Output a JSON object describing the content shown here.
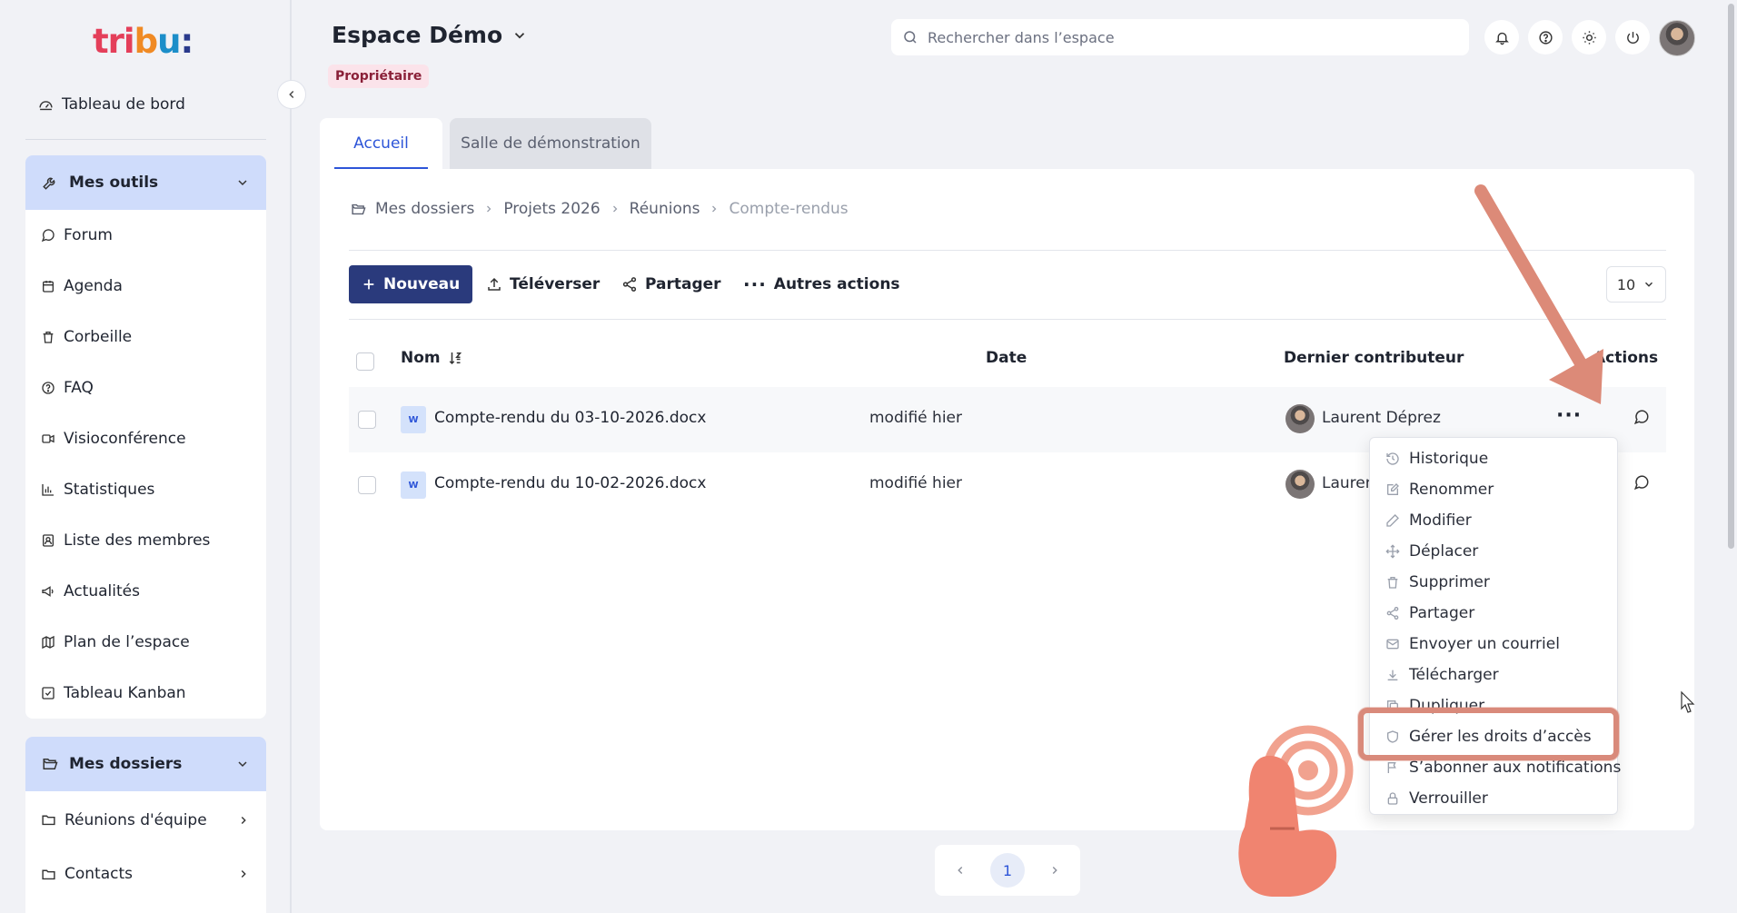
{
  "sidebar": {
    "logo_parts": [
      "tri",
      "b",
      "u",
      ":"
    ],
    "dashboard_label": "Tableau de bord",
    "tools_header": "Mes outils",
    "tools": [
      {
        "label": "Forum",
        "icon": "forum-icon"
      },
      {
        "label": "Agenda",
        "icon": "calendar-icon"
      },
      {
        "label": "Corbeille",
        "icon": "trash-icon"
      },
      {
        "label": "FAQ",
        "icon": "help-icon"
      },
      {
        "label": "Visioconférence",
        "icon": "video-icon"
      },
      {
        "label": "Statistiques",
        "icon": "chart-icon"
      },
      {
        "label": "Liste des membres",
        "icon": "members-icon"
      },
      {
        "label": "Actualités",
        "icon": "megaphone-icon"
      },
      {
        "label": "Plan de l’espace",
        "icon": "map-icon"
      },
      {
        "label": "Tableau Kanban",
        "icon": "kanban-icon"
      }
    ],
    "folders_header": "Mes dossiers",
    "folders": [
      {
        "label": "Réunions d'équipe"
      },
      {
        "label": "Contacts"
      }
    ]
  },
  "header": {
    "space_title": "Espace Démo",
    "role_badge": "Propriétaire",
    "search_placeholder": "Rechercher dans l’espace"
  },
  "tabs": [
    {
      "label": "Accueil",
      "active": true
    },
    {
      "label": "Salle de démonstration",
      "active": false
    }
  ],
  "breadcrumb": [
    "Mes dossiers",
    "Projets 2026",
    "Réunions",
    "Compte-rendus"
  ],
  "toolbar": {
    "new_label": "Nouveau",
    "upload_label": "Téléverser",
    "share_label": "Partager",
    "more_label": "Autres actions",
    "per_page": "10"
  },
  "table": {
    "headers": {
      "name": "Nom",
      "date": "Date",
      "contributor": "Dernier contributeur",
      "actions": "Actions"
    },
    "rows": [
      {
        "type": "W",
        "name": "Compte-rendu du 03-10-2026.docx",
        "date": "modifié hier",
        "contributor": "Laurent Déprez"
      },
      {
        "type": "W",
        "name": "Compte-rendu du 10-02-2026.docx",
        "date": "modifié hier",
        "contributor": "Laurent Déprez"
      }
    ]
  },
  "action_menu": [
    {
      "label": "Historique",
      "icon": "history-icon"
    },
    {
      "label": "Renommer",
      "icon": "rename-icon"
    },
    {
      "label": "Modifier",
      "icon": "pencil-icon"
    },
    {
      "label": "Déplacer",
      "icon": "move-icon"
    },
    {
      "label": "Supprimer",
      "icon": "trash-icon"
    },
    {
      "label": "Partager",
      "icon": "share-icon"
    },
    {
      "label": "Envoyer un courriel",
      "icon": "mail-icon"
    },
    {
      "label": "Télécharger",
      "icon": "download-icon"
    },
    {
      "label": "Dupliquer",
      "icon": "duplicate-icon"
    },
    {
      "label": "Gérer les droits d’accès",
      "icon": "shield-icon"
    },
    {
      "label": "S’abonner aux notifications",
      "icon": "flag-icon"
    },
    {
      "label": "Verrouiller",
      "icon": "lock-icon"
    }
  ],
  "pagination": {
    "current_page": "1"
  },
  "colors": {
    "accent": "#2d55d8",
    "primary_button": "#2a3a7c",
    "annotation": "#d98a7b",
    "sidebar_header": "#cfdcfb"
  }
}
